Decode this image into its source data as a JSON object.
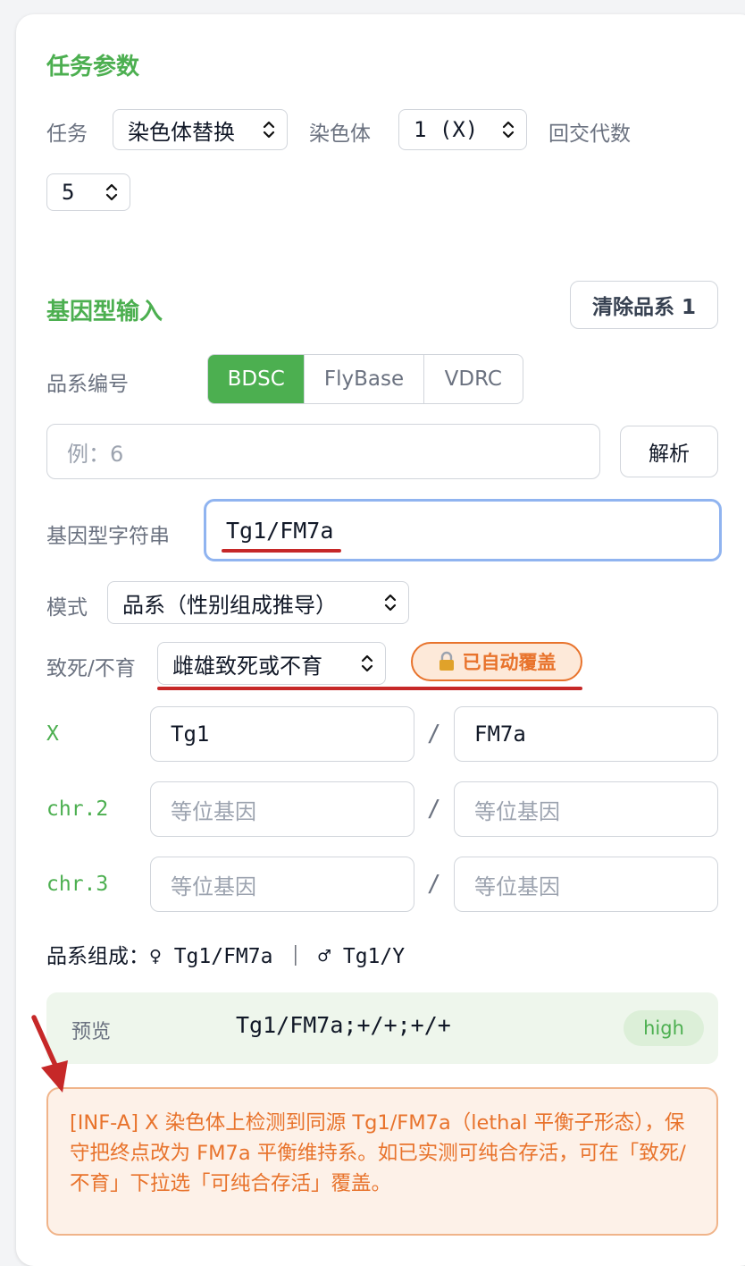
{
  "task_params": {
    "title": "任务参数",
    "task_label": "任务",
    "task_value": "染色体替换",
    "chromosome_label": "染色体",
    "chromosome_value": "1 (X)",
    "backcross_label": "回交代数",
    "backcross_value": "5"
  },
  "genotype_input": {
    "title": "基因型输入",
    "clear_button": "清除品系 1",
    "stock_label": "品系编号",
    "sources": [
      "BDSC",
      "FlyBase",
      "VDRC"
    ],
    "active_source": "BDSC",
    "stock_placeholder": "例：6",
    "parse_button": "解析",
    "genotype_string_label": "基因型字符串",
    "genotype_string_value": "Tg1/FM7a",
    "mode_label": "模式",
    "mode_value": "品系（性别组成推导）",
    "lethal_label": "致死/不育",
    "lethal_value": "雌雄致死或不育",
    "override_badge": "已自动覆盖",
    "chromosomes": [
      {
        "name": "X",
        "allele1": "Tg1",
        "allele2": "FM7a"
      },
      {
        "name": "chr.2",
        "allele1": "",
        "allele2": ""
      },
      {
        "name": "chr.3",
        "allele1": "",
        "allele2": ""
      }
    ],
    "allele_placeholder": "等位基因",
    "separator": "/",
    "composition": "品系组成：♀ Tg1/FM7a ｜ ♂ Tg1/Y",
    "preview_label": "预览",
    "preview_value": "Tg1/FM7a;+/+;+/+",
    "preview_badge": "high",
    "warning": "[INF-A] X 染色体上检测到同源 Tg1/FM7a（lethal 平衡子形态），保守把终点改为 FM7a 平衡维持系。如已实测可纯合存活，可在「致死/不育」下拉选「可纯合存活」覆盖。"
  },
  "colors": {
    "accent_green": "#4caf50",
    "annotation_red": "#c62828",
    "badge_orange": "#e8732c",
    "focus_blue": "#90b4f0"
  }
}
